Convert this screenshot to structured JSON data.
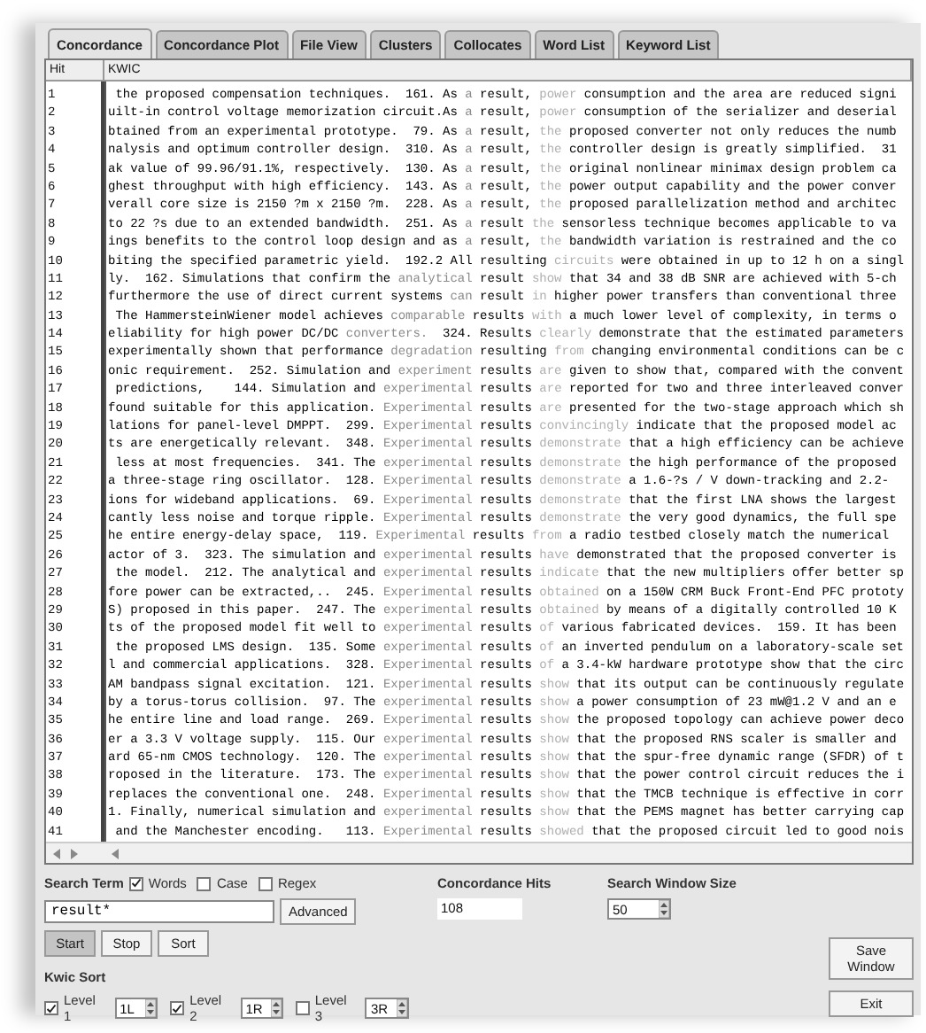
{
  "tabs": [
    {
      "label": "Concordance",
      "selected": true
    },
    {
      "label": "Concordance Plot",
      "selected": false
    },
    {
      "label": "File View",
      "selected": false
    },
    {
      "label": "Clusters",
      "selected": false
    },
    {
      "label": "Collocates",
      "selected": false
    },
    {
      "label": "Word List",
      "selected": false
    },
    {
      "label": "Keyword List",
      "selected": false
    }
  ],
  "table": {
    "columns": [
      "Hit",
      "KWIC"
    ],
    "rows": [
      {
        "hit": "1",
        "parts": [
          {
            "kind": "plain",
            "text": " the proposed compensation techniques.  161. As "
          },
          {
            "kind": "l1",
            "text": "a"
          },
          {
            "kind": "plain",
            "text": " result, "
          },
          {
            "kind": "r1",
            "text": "power"
          },
          {
            "kind": "plain",
            "text": " consumption and the area are reduced signi"
          }
        ]
      },
      {
        "hit": "2",
        "parts": [
          {
            "kind": "plain",
            "text": "uilt-in control voltage memorization circuit.As "
          },
          {
            "kind": "l1",
            "text": "a"
          },
          {
            "kind": "plain",
            "text": " result, "
          },
          {
            "kind": "r1",
            "text": "power"
          },
          {
            "kind": "plain",
            "text": " consumption of the serializer and deserial"
          }
        ]
      },
      {
        "hit": "3",
        "parts": [
          {
            "kind": "plain",
            "text": "btained from an experimental prototype.  79. As "
          },
          {
            "kind": "l1",
            "text": "a"
          },
          {
            "kind": "plain",
            "text": " result, "
          },
          {
            "kind": "r1",
            "text": "the"
          },
          {
            "kind": "plain",
            "text": " proposed converter not only reduces the numb"
          }
        ]
      },
      {
        "hit": "4",
        "parts": [
          {
            "kind": "plain",
            "text": "nalysis and optimum controller design.  310. As "
          },
          {
            "kind": "l1",
            "text": "a"
          },
          {
            "kind": "plain",
            "text": " result, "
          },
          {
            "kind": "r1",
            "text": "the"
          },
          {
            "kind": "plain",
            "text": " controller design is greatly simplified.  31"
          }
        ]
      },
      {
        "hit": "5",
        "parts": [
          {
            "kind": "plain",
            "text": "ak value of 99.96/91.1%, respectively.  130. As "
          },
          {
            "kind": "l1",
            "text": "a"
          },
          {
            "kind": "plain",
            "text": " result, "
          },
          {
            "kind": "r1",
            "text": "the"
          },
          {
            "kind": "plain",
            "text": " original nonlinear minimax design problem ca"
          }
        ]
      },
      {
        "hit": "6",
        "parts": [
          {
            "kind": "plain",
            "text": "ghest throughput with high efficiency.  143. As "
          },
          {
            "kind": "l1",
            "text": "a"
          },
          {
            "kind": "plain",
            "text": " result, "
          },
          {
            "kind": "r1",
            "text": "the"
          },
          {
            "kind": "plain",
            "text": " power output capability and the power conver"
          }
        ]
      },
      {
        "hit": "7",
        "parts": [
          {
            "kind": "plain",
            "text": "verall core size is 2150 ?m x 2150 ?m.  228. As "
          },
          {
            "kind": "l1",
            "text": "a"
          },
          {
            "kind": "plain",
            "text": " result, "
          },
          {
            "kind": "r1",
            "text": "the"
          },
          {
            "kind": "plain",
            "text": " proposed parallelization method and architec"
          }
        ]
      },
      {
        "hit": "8",
        "parts": [
          {
            "kind": "plain",
            "text": "to 22 ?s due to an extended bandwidth.  251. As "
          },
          {
            "kind": "l1",
            "text": "a"
          },
          {
            "kind": "plain",
            "text": " result "
          },
          {
            "kind": "r1",
            "text": "the"
          },
          {
            "kind": "plain",
            "text": " sensorless technique becomes applicable to va"
          }
        ]
      },
      {
        "hit": "9",
        "parts": [
          {
            "kind": "plain",
            "text": "ings benefits to the control loop design and as "
          },
          {
            "kind": "l1",
            "text": "a"
          },
          {
            "kind": "plain",
            "text": " result, "
          },
          {
            "kind": "r1",
            "text": "the"
          },
          {
            "kind": "plain",
            "text": " bandwidth variation is restrained and the co"
          }
        ]
      },
      {
        "hit": "10",
        "parts": [
          {
            "kind": "plain",
            "text": "biting the specified parametric yield.  192.2 All resulting "
          },
          {
            "kind": "r1",
            "text": "circuits"
          },
          {
            "kind": "plain",
            "text": " were obtained in up to 12 h on a singl"
          }
        ]
      },
      {
        "hit": "11",
        "parts": [
          {
            "kind": "plain",
            "text": "ly.  162. Simulations that confirm the "
          },
          {
            "kind": "l1",
            "text": "analytical"
          },
          {
            "kind": "plain",
            "text": " result "
          },
          {
            "kind": "r1",
            "text": "show"
          },
          {
            "kind": "plain",
            "text": " that 34 and 38 dB SNR are achieved with 5-ch"
          }
        ]
      },
      {
        "hit": "12",
        "parts": [
          {
            "kind": "plain",
            "text": "furthermore the use of direct current systems "
          },
          {
            "kind": "l1",
            "text": "can"
          },
          {
            "kind": "plain",
            "text": " result "
          },
          {
            "kind": "r1",
            "text": "in"
          },
          {
            "kind": "plain",
            "text": " higher power transfers than conventional three"
          }
        ]
      },
      {
        "hit": "13",
        "parts": [
          {
            "kind": "plain",
            "text": " The HammersteinWiener model achieves "
          },
          {
            "kind": "l1",
            "text": "comparable"
          },
          {
            "kind": "plain",
            "text": " results "
          },
          {
            "kind": "r1",
            "text": "with"
          },
          {
            "kind": "plain",
            "text": " a much lower level of complexity, in terms o"
          }
        ]
      },
      {
        "hit": "14",
        "parts": [
          {
            "kind": "plain",
            "text": "eliability for high power DC/DC "
          },
          {
            "kind": "l1",
            "text": "converters."
          },
          {
            "kind": "plain",
            "text": "  324. Results "
          },
          {
            "kind": "r1",
            "text": "clearly"
          },
          {
            "kind": "plain",
            "text": " demonstrate that the estimated parameters"
          }
        ]
      },
      {
        "hit": "15",
        "parts": [
          {
            "kind": "plain",
            "text": "experimentally shown that performance "
          },
          {
            "kind": "l1",
            "text": "degradation"
          },
          {
            "kind": "plain",
            "text": " resulting "
          },
          {
            "kind": "r1",
            "text": "from"
          },
          {
            "kind": "plain",
            "text": " changing environmental conditions can be c"
          }
        ]
      },
      {
        "hit": "16",
        "parts": [
          {
            "kind": "plain",
            "text": "onic requirement.  252. Simulation and "
          },
          {
            "kind": "l1",
            "text": "experiment"
          },
          {
            "kind": "plain",
            "text": " results "
          },
          {
            "kind": "r1",
            "text": "are"
          },
          {
            "kind": "plain",
            "text": " given to show that, compared with the convent"
          }
        ]
      },
      {
        "hit": "17",
        "parts": [
          {
            "kind": "plain",
            "text": " predictions,    144. Simulation and "
          },
          {
            "kind": "l1",
            "text": "experimental"
          },
          {
            "kind": "plain",
            "text": " results "
          },
          {
            "kind": "r1",
            "text": "are"
          },
          {
            "kind": "plain",
            "text": " reported for two and three interleaved conver"
          }
        ]
      },
      {
        "hit": "18",
        "parts": [
          {
            "kind": "plain",
            "text": "found suitable for this application. "
          },
          {
            "kind": "l1",
            "text": "Experimental"
          },
          {
            "kind": "plain",
            "text": " results "
          },
          {
            "kind": "r1",
            "text": "are"
          },
          {
            "kind": "plain",
            "text": " presented for the two-stage approach which sh"
          }
        ]
      },
      {
        "hit": "19",
        "parts": [
          {
            "kind": "plain",
            "text": "lations for panel-level DMPPT.  299. "
          },
          {
            "kind": "l1",
            "text": "Experimental"
          },
          {
            "kind": "plain",
            "text": " results "
          },
          {
            "kind": "r1",
            "text": "convincingly"
          },
          {
            "kind": "plain",
            "text": " indicate that the proposed model ac"
          }
        ]
      },
      {
        "hit": "20",
        "parts": [
          {
            "kind": "plain",
            "text": "ts are energetically relevant.  348. "
          },
          {
            "kind": "l1",
            "text": "Experimental"
          },
          {
            "kind": "plain",
            "text": " results "
          },
          {
            "kind": "r1",
            "text": "demonstrate"
          },
          {
            "kind": "plain",
            "text": " that a high efficiency can be achieve"
          }
        ]
      },
      {
        "hit": "21",
        "parts": [
          {
            "kind": "plain",
            "text": " less at most frequencies.  341. The "
          },
          {
            "kind": "l1",
            "text": "experimental"
          },
          {
            "kind": "plain",
            "text": " results "
          },
          {
            "kind": "r1",
            "text": "demonstrate"
          },
          {
            "kind": "plain",
            "text": " the high performance of the proposed"
          }
        ]
      },
      {
        "hit": "22",
        "parts": [
          {
            "kind": "plain",
            "text": "a three-stage ring oscillator.  128. "
          },
          {
            "kind": "l1",
            "text": "Experimental"
          },
          {
            "kind": "plain",
            "text": " results "
          },
          {
            "kind": "r1",
            "text": "demonstrate"
          },
          {
            "kind": "plain",
            "text": " a 1.6-?s / V down-tracking and 2.2-"
          }
        ]
      },
      {
        "hit": "23",
        "parts": [
          {
            "kind": "plain",
            "text": "ions for wideband applications.  69. "
          },
          {
            "kind": "l1",
            "text": "Experimental"
          },
          {
            "kind": "plain",
            "text": " results "
          },
          {
            "kind": "r1",
            "text": "demonstrate"
          },
          {
            "kind": "plain",
            "text": " that the first LNA shows the largest"
          }
        ]
      },
      {
        "hit": "24",
        "parts": [
          {
            "kind": "plain",
            "text": "cantly less noise and torque ripple. "
          },
          {
            "kind": "l1",
            "text": "Experimental"
          },
          {
            "kind": "plain",
            "text": " results "
          },
          {
            "kind": "r1",
            "text": "demonstrate"
          },
          {
            "kind": "plain",
            "text": " the very good dynamics, the full spe"
          }
        ]
      },
      {
        "hit": "25",
        "parts": [
          {
            "kind": "plain",
            "text": "he entire energy-delay space,  119. "
          },
          {
            "kind": "l1",
            "text": "Experimental"
          },
          {
            "kind": "plain",
            "text": " results "
          },
          {
            "kind": "r1",
            "text": "from"
          },
          {
            "kind": "plain",
            "text": " a radio testbed closely match the numerical"
          }
        ]
      },
      {
        "hit": "26",
        "parts": [
          {
            "kind": "plain",
            "text": "actor of 3.  323. The simulation and "
          },
          {
            "kind": "l1",
            "text": "experimental"
          },
          {
            "kind": "plain",
            "text": " results "
          },
          {
            "kind": "r1",
            "text": "have"
          },
          {
            "kind": "plain",
            "text": " demonstrated that the proposed converter is"
          }
        ]
      },
      {
        "hit": "27",
        "parts": [
          {
            "kind": "plain",
            "text": " the model.  212. The analytical and "
          },
          {
            "kind": "l1",
            "text": "experimental"
          },
          {
            "kind": "plain",
            "text": " results "
          },
          {
            "kind": "r1",
            "text": "indicate"
          },
          {
            "kind": "plain",
            "text": " that the new multipliers offer better sp"
          }
        ]
      },
      {
        "hit": "28",
        "parts": [
          {
            "kind": "plain",
            "text": "fore power can be extracted,..  245. "
          },
          {
            "kind": "l1",
            "text": "Experimental"
          },
          {
            "kind": "plain",
            "text": " results "
          },
          {
            "kind": "r1",
            "text": "obtained"
          },
          {
            "kind": "plain",
            "text": " on a 150W CRM Buck Front-End PFC prototy"
          }
        ]
      },
      {
        "hit": "29",
        "parts": [
          {
            "kind": "plain",
            "text": "S) proposed in this paper.  247. The "
          },
          {
            "kind": "l1",
            "text": "experimental"
          },
          {
            "kind": "plain",
            "text": " results "
          },
          {
            "kind": "r1",
            "text": "obtained"
          },
          {
            "kind": "plain",
            "text": " by means of a digitally controlled 10 K"
          }
        ]
      },
      {
        "hit": "30",
        "parts": [
          {
            "kind": "plain",
            "text": "ts of the proposed model fit well to "
          },
          {
            "kind": "l1",
            "text": "experimental"
          },
          {
            "kind": "plain",
            "text": " results "
          },
          {
            "kind": "r1",
            "text": "of"
          },
          {
            "kind": "plain",
            "text": " various fabricated devices.  159. It has been"
          }
        ]
      },
      {
        "hit": "31",
        "parts": [
          {
            "kind": "plain",
            "text": " the proposed LMS design.  135. Some "
          },
          {
            "kind": "l1",
            "text": "experimental"
          },
          {
            "kind": "plain",
            "text": " results "
          },
          {
            "kind": "r1",
            "text": "of"
          },
          {
            "kind": "plain",
            "text": " an inverted pendulum on a laboratory-scale set"
          }
        ]
      },
      {
        "hit": "32",
        "parts": [
          {
            "kind": "plain",
            "text": "l and commercial applications.  328. "
          },
          {
            "kind": "l1",
            "text": "Experimental"
          },
          {
            "kind": "plain",
            "text": " results "
          },
          {
            "kind": "r1",
            "text": "of"
          },
          {
            "kind": "plain",
            "text": " a 3.4-kW hardware prototype show that the circ"
          }
        ]
      },
      {
        "hit": "33",
        "parts": [
          {
            "kind": "plain",
            "text": "AM bandpass signal excitation.  121. "
          },
          {
            "kind": "l1",
            "text": "Experimental"
          },
          {
            "kind": "plain",
            "text": " results "
          },
          {
            "kind": "r1",
            "text": "show"
          },
          {
            "kind": "plain",
            "text": " that its output can be continuously regulate"
          }
        ]
      },
      {
        "hit": "34",
        "parts": [
          {
            "kind": "plain",
            "text": "by a torus-torus collision.  97. The "
          },
          {
            "kind": "l1",
            "text": "experimental"
          },
          {
            "kind": "plain",
            "text": " results "
          },
          {
            "kind": "r1",
            "text": "show"
          },
          {
            "kind": "plain",
            "text": " a power consumption of 23 mW@1.2 V and an e"
          }
        ]
      },
      {
        "hit": "35",
        "parts": [
          {
            "kind": "plain",
            "text": "he entire line and load range.  269. "
          },
          {
            "kind": "l1",
            "text": "Experimental"
          },
          {
            "kind": "plain",
            "text": " results "
          },
          {
            "kind": "r1",
            "text": "show"
          },
          {
            "kind": "plain",
            "text": " the proposed topology can achieve power deco"
          }
        ]
      },
      {
        "hit": "36",
        "parts": [
          {
            "kind": "plain",
            "text": "er a 3.3 V voltage supply.  115. Our "
          },
          {
            "kind": "l1",
            "text": "experimental"
          },
          {
            "kind": "plain",
            "text": " results "
          },
          {
            "kind": "r1",
            "text": "show"
          },
          {
            "kind": "plain",
            "text": " that the proposed RNS scaler is smaller and"
          }
        ]
      },
      {
        "hit": "37",
        "parts": [
          {
            "kind": "plain",
            "text": "ard 65-nm CMOS technology.  120. The "
          },
          {
            "kind": "l1",
            "text": "experimental"
          },
          {
            "kind": "plain",
            "text": " results "
          },
          {
            "kind": "r1",
            "text": "show"
          },
          {
            "kind": "plain",
            "text": " that the spur-free dynamic range (SFDR) of t"
          }
        ]
      },
      {
        "hit": "38",
        "parts": [
          {
            "kind": "plain",
            "text": "roposed in the literature.  173. The "
          },
          {
            "kind": "l1",
            "text": "experimental"
          },
          {
            "kind": "plain",
            "text": " results "
          },
          {
            "kind": "r1",
            "text": "show"
          },
          {
            "kind": "plain",
            "text": " that the power control circuit reduces the i"
          }
        ]
      },
      {
        "hit": "39",
        "parts": [
          {
            "kind": "plain",
            "text": "replaces the conventional one.  248. "
          },
          {
            "kind": "l1",
            "text": "Experimental"
          },
          {
            "kind": "plain",
            "text": " results "
          },
          {
            "kind": "r1",
            "text": "show"
          },
          {
            "kind": "plain",
            "text": " that the TMCB technique is effective in corr"
          }
        ]
      },
      {
        "hit": "40",
        "parts": [
          {
            "kind": "plain",
            "text": "1. Finally, numerical simulation and "
          },
          {
            "kind": "l1",
            "text": "experimental"
          },
          {
            "kind": "plain",
            "text": " results "
          },
          {
            "kind": "r1",
            "text": "show"
          },
          {
            "kind": "plain",
            "text": " that the PEMS magnet has better carrying cap"
          }
        ]
      },
      {
        "hit": "41",
        "parts": [
          {
            "kind": "plain",
            "text": " and the Manchester encoding.   113. "
          },
          {
            "kind": "l1",
            "text": "Experimental"
          },
          {
            "kind": "plain",
            "text": " results "
          },
          {
            "kind": "r1",
            "text": "showed"
          },
          {
            "kind": "plain",
            "text": " that the proposed circuit led to good nois"
          }
        ]
      }
    ]
  },
  "search": {
    "label": "Search Term",
    "options": [
      {
        "label": "Words",
        "checked": true
      },
      {
        "label": "Case",
        "checked": false
      },
      {
        "label": "Regex",
        "checked": false
      }
    ],
    "value": "result*",
    "advanced": "Advanced"
  },
  "hits": {
    "label": "Concordance Hits",
    "value": "108"
  },
  "window_size": {
    "label": "Search Window Size",
    "value": "50"
  },
  "actions": [
    {
      "label": "Start",
      "selected": true
    },
    {
      "label": "Stop",
      "selected": false
    },
    {
      "label": "Sort",
      "selected": false
    }
  ],
  "kwic_sort": {
    "label": "Kwic Sort",
    "levels": [
      {
        "label": "Level 1",
        "checked": true,
        "value": "1L"
      },
      {
        "label": "Level 2",
        "checked": true,
        "value": "1R"
      },
      {
        "label": "Level 3",
        "checked": false,
        "value": "3R"
      }
    ]
  },
  "side_buttons": [
    "Save Window",
    "Exit"
  ]
}
